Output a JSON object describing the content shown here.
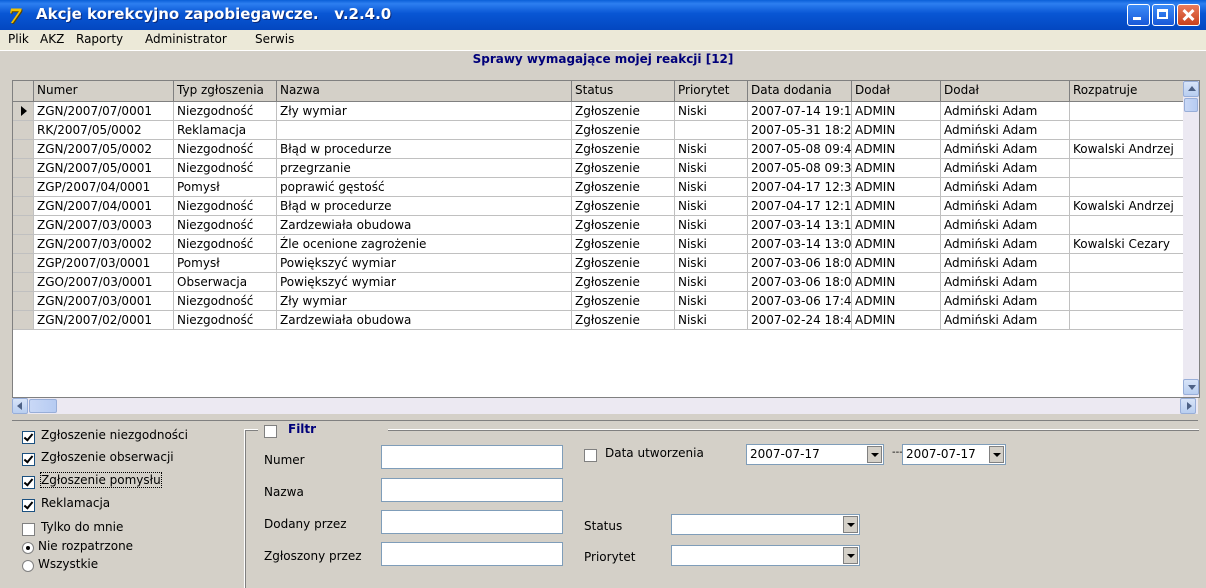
{
  "window": {
    "icon_glyph": "7",
    "title": "Akcje korekcyjno zapobiegawcze.   v.2.4.0"
  },
  "menu": [
    "Plik",
    "AKZ",
    "Raporty",
    "Administrator",
    "Serwis"
  ],
  "grid": {
    "caption": "Sprawy wymagające mojej reakcji [12]",
    "columns": [
      "Numer",
      "Typ zgłoszenia",
      "Nazwa",
      "Status",
      "Priorytet",
      "Data dodania",
      "Dodał",
      "Dodał",
      "Rozpatruje"
    ],
    "current_row": 0,
    "rows": [
      [
        "ZGN/2007/07/0001",
        "Niezgodność",
        "Zły wymiar",
        "Zgłoszenie",
        "Niski",
        "2007-07-14 19:1",
        "ADMIN",
        "Admiński Adam",
        ""
      ],
      [
        "RK/2007/05/0002",
        "Reklamacja",
        "",
        "Zgłoszenie",
        "",
        "2007-05-31 18:2",
        "ADMIN",
        "Admiński Adam",
        ""
      ],
      [
        "ZGN/2007/05/0002",
        "Niezgodność",
        "Błąd w procedurze",
        "Zgłoszenie",
        "Niski",
        "2007-05-08 09:4",
        "ADMIN",
        "Admiński Adam",
        "Kowalski Andrzej"
      ],
      [
        "ZGN/2007/05/0001",
        "Niezgodność",
        "przegrzanie",
        "Zgłoszenie",
        "Niski",
        "2007-05-08 09:3",
        "ADMIN",
        "Admiński Adam",
        ""
      ],
      [
        "ZGP/2007/04/0001",
        "Pomysł",
        "poprawić gęstość",
        "Zgłoszenie",
        "Niski",
        "2007-04-17 12:3",
        "ADMIN",
        "Admiński Adam",
        ""
      ],
      [
        "ZGN/2007/04/0001",
        "Niezgodność",
        "Błąd w procedurze",
        "Zgłoszenie",
        "Niski",
        "2007-04-17 12:1",
        "ADMIN",
        "Admiński Adam",
        "Kowalski Andrzej"
      ],
      [
        "ZGN/2007/03/0003",
        "Niezgodność",
        "Zardzewiała obudowa",
        "Zgłoszenie",
        "Niski",
        "2007-03-14 13:1",
        "ADMIN",
        "Admiński Adam",
        ""
      ],
      [
        "ZGN/2007/03/0002",
        "Niezgodność",
        "Źle ocenione zagrożenie",
        "Zgłoszenie",
        "Niski",
        "2007-03-14 13:0",
        "ADMIN",
        "Admiński Adam",
        "Kowalski Cezary"
      ],
      [
        "ZGP/2007/03/0001",
        "Pomysł",
        "Powiększyć wymiar",
        "Zgłoszenie",
        "Niski",
        "2007-03-06 18:0",
        "ADMIN",
        "Admiński Adam",
        ""
      ],
      [
        "ZGO/2007/03/0001",
        "Obserwacja",
        "Powiększyć wymiar",
        "Zgłoszenie",
        "Niski",
        "2007-03-06 18:0",
        "ADMIN",
        "Admiński Adam",
        ""
      ],
      [
        "ZGN/2007/03/0001",
        "Niezgodność",
        "Zły wymiar",
        "Zgłoszenie",
        "Niski",
        "2007-03-06 17:4",
        "ADMIN",
        "Admiński Adam",
        ""
      ],
      [
        "ZGN/2007/02/0001",
        "Niezgodność",
        "Zardzewiała obudowa",
        "Zgłoszenie",
        "Niski",
        "2007-02-24 18:4",
        "ADMIN",
        "Admiński Adam",
        ""
      ]
    ]
  },
  "types": [
    {
      "label": "Zgłoszenie niezgodności",
      "checked": true
    },
    {
      "label": "Zgłoszenie obserwacji",
      "checked": true
    },
    {
      "label": "Zgłoszenie pomysłu",
      "checked": true
    },
    {
      "label": "Reklamacja",
      "checked": true
    }
  ],
  "only_mine": {
    "label": "Tylko do mnie",
    "checked": false
  },
  "scope": [
    {
      "label": "Nie rozpatrzone",
      "selected": true
    },
    {
      "label": "Wszystkie",
      "selected": false
    }
  ],
  "filter": {
    "title": "Filtr",
    "enabled": false,
    "numer_label": "Numer",
    "numer_value": "",
    "nazwa_label": "Nazwa",
    "nazwa_value": "",
    "dodany_label": "Dodany przez",
    "dodany_value": "",
    "zgloszony_label": "Zgłoszony przez",
    "zgloszony_value": "",
    "date_label": "Data utworzenia",
    "date_checked": false,
    "date_from": "2007-07-17",
    "date_sep": "---",
    "date_to": "2007-07-17",
    "status_label": "Status",
    "status_value": "",
    "priorytet_label": "Priorytet",
    "priorytet_value": ""
  }
}
